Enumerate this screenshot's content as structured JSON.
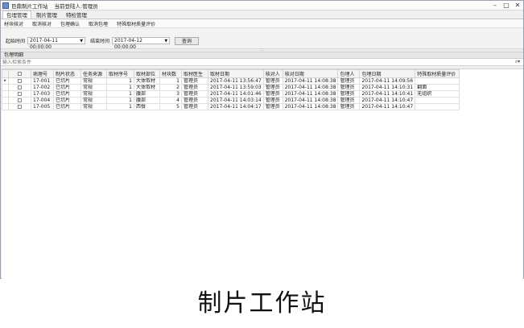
{
  "window": {
    "app_title": "巨鼎制片工作站",
    "user_prefix": "当前登陆人:",
    "user_name": "管理员"
  },
  "tabs": [
    "包埋管理",
    "制片管理",
    "特检管理"
  ],
  "subtabs": [
    "材块核对",
    "取消核对",
    "包埋确认",
    "取消包埋",
    "特殊取材质量评价"
  ],
  "filter": {
    "start_label": "起始时间",
    "start_value": "2017-04-11 00:00:00",
    "end_label": "结束时间",
    "end_value": "2017-04-12 00:00:00",
    "query_label": "查询"
  },
  "group_label": "包埋明细",
  "search_placeholder": "输入检索条件",
  "table": {
    "headers": [
      "病理号",
      "制片状态",
      "任务来源",
      "取材序号",
      "取材部位",
      "材块数",
      "取材医生",
      "取材日期",
      "核对人",
      "核对日期",
      "包埋人",
      "包埋日期",
      "特殊取材质量评价"
    ],
    "rows": [
      [
        "17-001",
        "已切片",
        "常规",
        "1",
        "大体取材",
        "1",
        "管理员",
        "2017-04-11 13:56:47",
        "管理员",
        "2017-04-11 14:08:38",
        "管理员",
        "2017-04-11 14:09:56",
        ""
      ],
      [
        "17-002",
        "已切片",
        "常规",
        "1",
        "大体取材",
        "2",
        "管理员",
        "2017-04-11 13:59:03",
        "管理员",
        "2017-04-11 14:08:38",
        "管理员",
        "2017-04-11 14:10:31",
        "翻面"
      ],
      [
        "17-003",
        "已切片",
        "常规",
        "1",
        "腹部",
        "3",
        "管理员",
        "2017-04-11 14:01:46",
        "管理员",
        "2017-04-11 14:08:38",
        "管理员",
        "2017-04-11 14:10:41",
        "无组织"
      ],
      [
        "17-004",
        "已切片",
        "常规",
        "1",
        "腹部",
        "4",
        "管理员",
        "2017-04-11 14:03:14",
        "管理员",
        "2017-04-11 14:08:38",
        "管理员",
        "2017-04-11 14:10:47",
        ""
      ],
      [
        "17-005",
        "已切片",
        "常规",
        "1",
        "西餐",
        "5",
        "管理员",
        "2017-04-11 14:04:17",
        "管理员",
        "2017-04-11 14:08:38",
        "管理员",
        "2017-04-11 14:10:47",
        ""
      ]
    ]
  },
  "caption": "制片工作站"
}
